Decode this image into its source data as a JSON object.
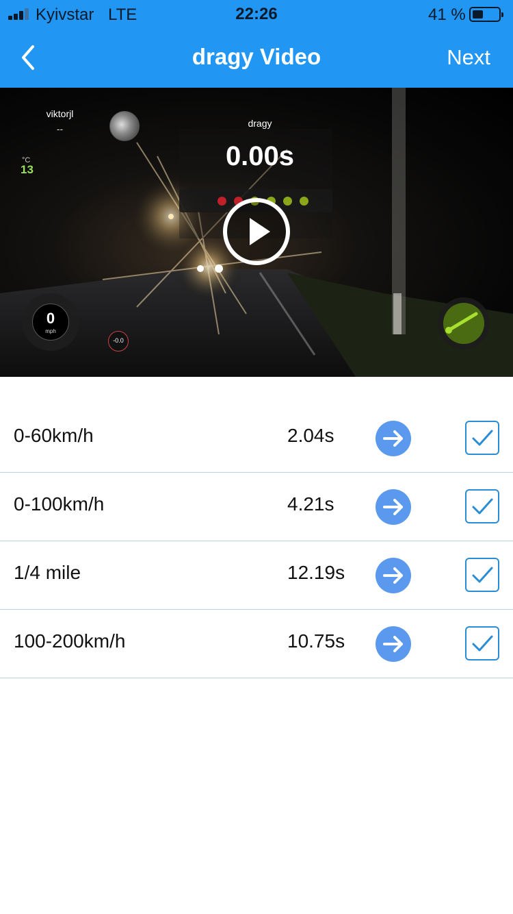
{
  "status_bar": {
    "carrier": "Kyivstar",
    "network": "LTE",
    "time": "22:26",
    "battery_percent": "41 %",
    "battery_level": 0.41
  },
  "nav": {
    "title": "dragy Video",
    "next_label": "Next",
    "back_icon": "chevron-left-icon",
    "color": "#2196f3"
  },
  "video": {
    "username": "viktorjl",
    "user_sub": "--",
    "temperature_unit": "°C",
    "temperature": "13",
    "brand": "dragy",
    "timer": "0.00s",
    "speed": "0",
    "speed_unit": "mph",
    "gforce": "-0.0",
    "start_lights": [
      "#c0202a",
      "#c0202a",
      "#8aa61a",
      "#8aa61a",
      "#8aa61a",
      "#8aa61a"
    ],
    "play_icon": "play-icon"
  },
  "results": [
    {
      "label": "0-60km/h",
      "time": "2.04s",
      "checked": true
    },
    {
      "label": "0-100km/h",
      "time": "4.21s",
      "checked": true
    },
    {
      "label": "1/4 mile",
      "time": "12.19s",
      "checked": true
    },
    {
      "label": "100-200km/h",
      "time": "10.75s",
      "checked": true
    }
  ],
  "colors": {
    "arrow_button": "#5b99ee",
    "checkbox": "#2a8dd4",
    "divider": "#b9d2e2"
  }
}
